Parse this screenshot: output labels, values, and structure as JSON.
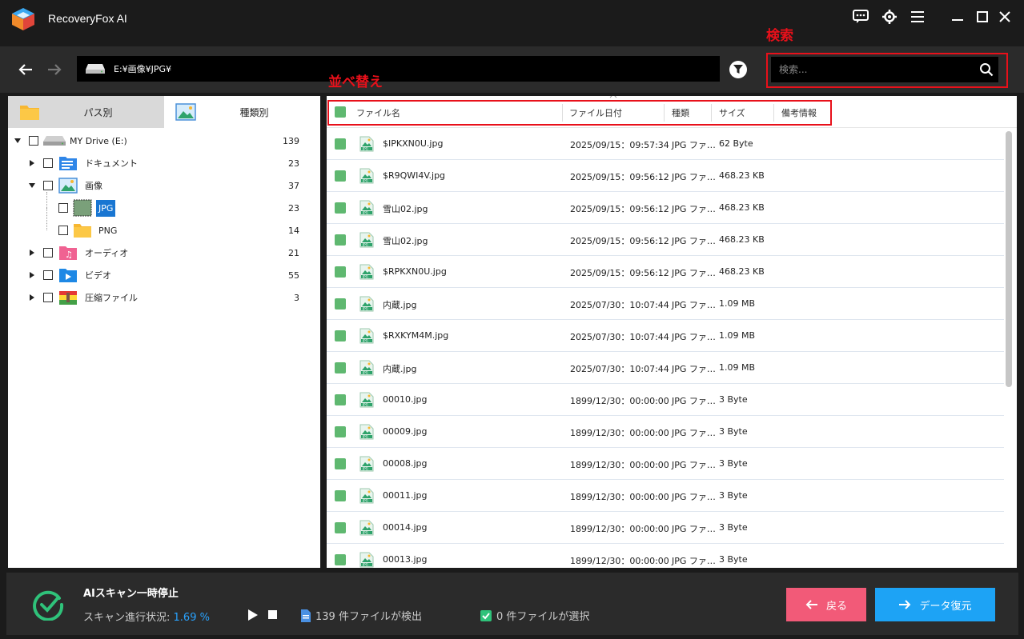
{
  "app": {
    "title": "RecoveryFox AI"
  },
  "nav": {
    "path": "E:¥画像¥JPG¥",
    "search_placeholder": "検索..."
  },
  "annotations": {
    "search": "検索",
    "sort": "並べ替え"
  },
  "tabs": [
    {
      "label": "パス別",
      "active": false
    },
    {
      "label": "種類別",
      "active": true
    }
  ],
  "tree": {
    "drive": {
      "label": "MY Drive (E:)",
      "count": "139"
    },
    "documents": {
      "label": "ドキュメント",
      "count": "23"
    },
    "images": {
      "label": "画像",
      "count": "37"
    },
    "jpg": {
      "label": "JPG",
      "count": "23"
    },
    "png": {
      "label": "PNG",
      "count": "14"
    },
    "audio": {
      "label": "オーディオ",
      "count": "21"
    },
    "video": {
      "label": "ビデオ",
      "count": "55"
    },
    "archive": {
      "label": "圧縮ファイル",
      "count": "3"
    }
  },
  "columns": {
    "name": "ファイル名",
    "date": "ファイル日付",
    "type": "種類",
    "size": "サイズ",
    "note": "備考情報"
  },
  "files": [
    {
      "name": "$IPKXN0U.jpg",
      "date": "2025/09/15：09:57:34",
      "type": "JPG ファ…",
      "size": "62 Byte"
    },
    {
      "name": "$R9QWI4V.jpg",
      "date": "2025/09/15：09:56:12",
      "type": "JPG ファ…",
      "size": "468.23 KB"
    },
    {
      "name": "雪山02.jpg",
      "date": "2025/09/15：09:56:12",
      "type": "JPG ファ…",
      "size": "468.23 KB"
    },
    {
      "name": "雪山02.jpg",
      "date": "2025/09/15：09:56:12",
      "type": "JPG ファ…",
      "size": "468.23 KB"
    },
    {
      "name": "$RPKXN0U.jpg",
      "date": "2025/09/15：09:56:12",
      "type": "JPG ファ…",
      "size": "468.23 KB"
    },
    {
      "name": "内蔵.jpg",
      "date": "2025/07/30：10:07:44",
      "type": "JPG ファ…",
      "size": "1.09 MB"
    },
    {
      "name": "$RXKYM4M.jpg",
      "date": "2025/07/30：10:07:44",
      "type": "JPG ファ…",
      "size": "1.09 MB"
    },
    {
      "name": "内蔵.jpg",
      "date": "2025/07/30：10:07:44",
      "type": "JPG ファ…",
      "size": "1.09 MB"
    },
    {
      "name": "00010.jpg",
      "date": "1899/12/30：00:00:00",
      "type": "JPG ファ…",
      "size": "3 Byte"
    },
    {
      "name": "00009.jpg",
      "date": "1899/12/30：00:00:00",
      "type": "JPG ファ…",
      "size": "3 Byte"
    },
    {
      "name": "00008.jpg",
      "date": "1899/12/30：00:00:00",
      "type": "JPG ファ…",
      "size": "3 Byte"
    },
    {
      "name": "00011.jpg",
      "date": "1899/12/30：00:00:00",
      "type": "JPG ファ…",
      "size": "3 Byte"
    },
    {
      "name": "00014.jpg",
      "date": "1899/12/30：00:00:00",
      "type": "JPG ファ…",
      "size": "3 Byte"
    },
    {
      "name": "00013.jpg",
      "date": "1899/12/30：00:00:00",
      "type": "JPG ファ…",
      "size": "3 Byte"
    }
  ],
  "status": {
    "title": "AIスキャン一時停止",
    "progress_label": "スキャン進行状況: ",
    "progress_value": "1.69 %",
    "found": "139 件ファイルが検出",
    "selected": "0 件ファイルが選択"
  },
  "buttons": {
    "back": "戻る",
    "recover": "データ復元"
  },
  "colors": {
    "accent": "#1da3f5",
    "back": "#f25a78",
    "annotation": "#e8101a",
    "checkbox_green": "#5fb870",
    "progress": "#29a3ff"
  }
}
